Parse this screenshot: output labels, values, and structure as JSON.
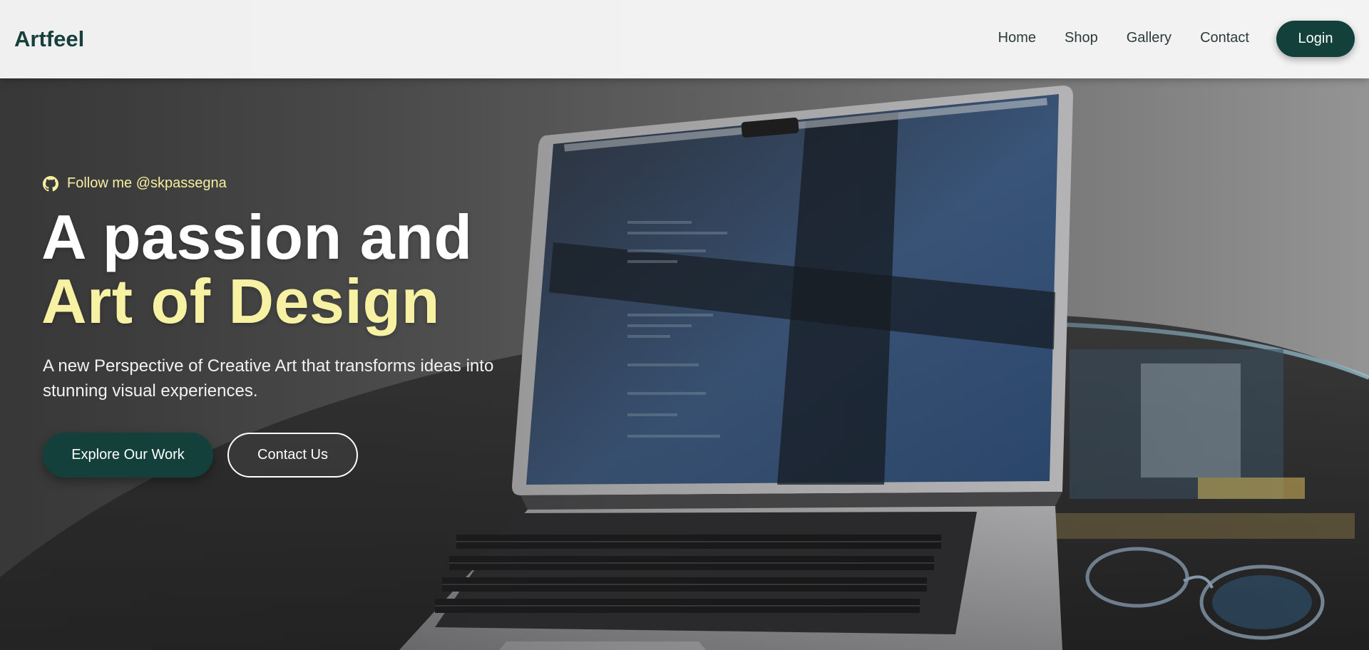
{
  "header": {
    "brand": "Artfeel",
    "nav": [
      "Home",
      "Shop",
      "Gallery",
      "Contact"
    ],
    "login_label": "Login"
  },
  "hero": {
    "follow_icon": "github-icon",
    "follow_text": "Follow me @skpassegna",
    "title_line1": "A passion and",
    "title_line2": "Art of Design",
    "subtitle": "A new Perspective of Creative Art that transforms ideas into stunning visual experiences.",
    "primary_button": "Explore Our Work",
    "secondary_button": "Contact Us",
    "background_image": "laptop-on-glass-table-photo"
  },
  "colors": {
    "brand": "#14403c",
    "accent_yellow": "#f7f1a3",
    "header_bg": "#f1f1f1"
  }
}
